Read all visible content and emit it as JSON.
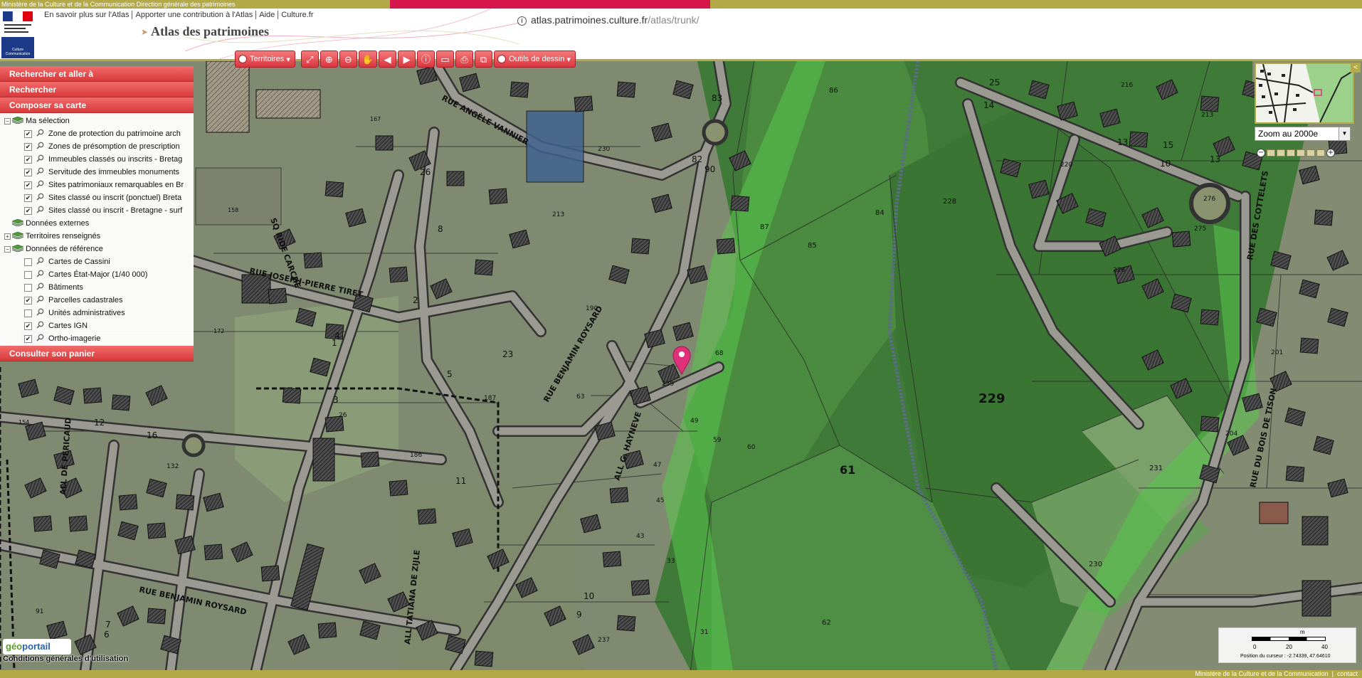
{
  "header": {
    "ministry_strip": "Ministère de la Culture et de la Communication Direction générale des patrimoines",
    "links": [
      "En savoir plus sur l'Atlas",
      "Apporter une contribution à l'Atlas",
      "Aide",
      "Culture.fr"
    ],
    "site_title": "Atlas des patrimoines",
    "url_host": "atlas.patrimoines.culture.fr",
    "url_path": "/atlas/trunk/",
    "logo_culture_text": "Culture Communication"
  },
  "toolbar": {
    "territoires_label": "Territoires",
    "outils_label": "Outils de dessin",
    "icons": [
      "full-extent-icon",
      "zoom-in-icon",
      "zoom-out-icon",
      "pan-hand-icon",
      "previous-view-icon",
      "next-view-icon",
      "info-icon",
      "measure-icon",
      "print-icon",
      "export-icon"
    ]
  },
  "panel": {
    "rechercher_aller": "Rechercher et aller à",
    "rechercher": "Rechercher",
    "composer": "Composer sa carte",
    "consulter": "Consulter son panier",
    "tree": [
      {
        "label": "Ma sélection",
        "kind": "group",
        "toggle": "−",
        "bold": true
      },
      {
        "label": "Zone de protection du patrimoine arch",
        "kind": "layer",
        "checked": true
      },
      {
        "label": "Zones de présomption de prescription",
        "kind": "layer",
        "checked": true
      },
      {
        "label": "Immeubles classés ou inscrits - Bretag",
        "kind": "layer",
        "checked": true
      },
      {
        "label": "Servitude des immeubles monuments",
        "kind": "layer",
        "checked": true
      },
      {
        "label": "Sites patrimoniaux remarquables en Br",
        "kind": "layer",
        "checked": true
      },
      {
        "label": "Sites classé ou inscrit (ponctuel) Breta",
        "kind": "layer",
        "checked": true
      },
      {
        "label": "Sites classé ou inscrit - Bretagne - surf",
        "kind": "layer",
        "checked": true
      },
      {
        "label": "Données externes",
        "kind": "group-noicon",
        "toggle": ""
      },
      {
        "label": "Territoires renseignés",
        "kind": "group",
        "toggle": "+"
      },
      {
        "label": "Données de référence",
        "kind": "group",
        "toggle": "−"
      },
      {
        "label": "Cartes de Cassini",
        "kind": "layer",
        "checked": false
      },
      {
        "label": "Cartes État-Major (1/40 000)",
        "kind": "layer",
        "checked": false
      },
      {
        "label": "Bâtiments",
        "kind": "layer",
        "checked": false
      },
      {
        "label": "Parcelles cadastrales",
        "kind": "layer",
        "checked": true
      },
      {
        "label": "Unités administratives",
        "kind": "layer",
        "checked": false
      },
      {
        "label": "Cartes IGN",
        "kind": "layer",
        "checked": true
      },
      {
        "label": "Ortho-imagerie",
        "kind": "layer",
        "checked": true
      }
    ]
  },
  "map": {
    "streets": [
      "RUE ANGÈLE VANNIER",
      "RUE JOSEPH-PIERRE TIRET",
      "RUE BENJAMIN ROYSARD",
      "RUE BENJAMIN ROYSARD",
      "RUE DES COTTELETS",
      "RUE DU BOIS DE TISON",
      "ALL TATIANA DE ZIJLE",
      "ALL G. HAYNEVE",
      "ALL DE PERICAUD",
      "SQ RIDE CARCHE"
    ],
    "parcels": [
      "229",
      "61",
      "228",
      "231",
      "230",
      "62",
      "85",
      "84",
      "86",
      "87",
      "60",
      "59",
      "49",
      "47",
      "45",
      "43",
      "33",
      "31",
      "239",
      "68",
      "63",
      "190",
      "187",
      "186",
      "213",
      "230",
      "237",
      "132",
      "154",
      "158",
      "172",
      "167",
      "276",
      "275",
      "226",
      "220",
      "216",
      "213",
      "204",
      "201",
      "10",
      "13",
      "15",
      "25",
      "14",
      "13",
      "16",
      "12",
      "11",
      "10",
      "9",
      "8",
      "7",
      "6",
      "5",
      "4",
      "3",
      "2",
      "1",
      "23",
      "26",
      "91",
      "26",
      "83",
      "90",
      "82"
    ]
  },
  "overview": {
    "expand": "<"
  },
  "zoom": {
    "selected": "Zoom au 2000e",
    "steps": 6
  },
  "scale": {
    "unit": "m",
    "labels": [
      "0",
      "20",
      "40"
    ],
    "cursor_position": "Position du curseur : -2.74339, 47.64610"
  },
  "geoportail": {
    "geo": "géo",
    "portail": "portail"
  },
  "cgu": "Conditions générales d'utilisation",
  "footer": {
    "ministry": "Ministère de la Culture et de la Communication",
    "contact": "contact"
  },
  "colors": {
    "accent_red": "#d9363f",
    "olive": "#b3aa47",
    "forest_green": "#5fa84a",
    "marker": "#e0307a"
  }
}
